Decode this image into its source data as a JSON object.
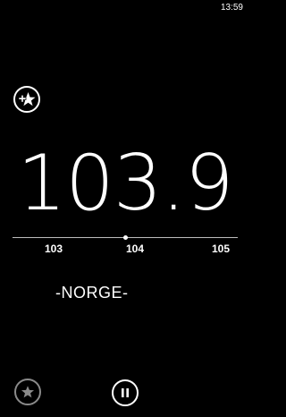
{
  "status_bar": {
    "time": "13:59"
  },
  "tuner": {
    "frequency": "103.9",
    "dial_ticks": [
      "103",
      "104",
      "105"
    ],
    "station_name": "-NORGE-"
  },
  "icons": {
    "add_favorite": "star-plus-icon",
    "favorites": "star-icon",
    "pause": "pause-icon"
  }
}
